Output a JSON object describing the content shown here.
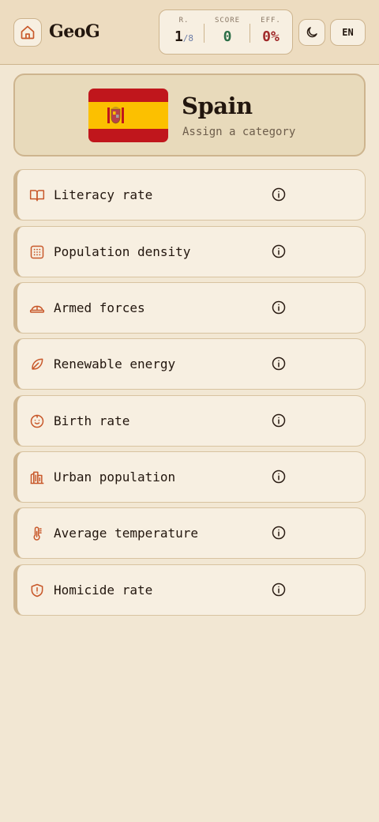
{
  "header": {
    "app_name": "GeoG",
    "home_icon": "home-icon",
    "stats": {
      "round_label": "R.",
      "round_value": "1",
      "round_total": "/8",
      "score_label": "SCORE",
      "score_value": "0",
      "efficiency_label": "EFF.",
      "efficiency_value": "0%"
    },
    "theme_icon": "moon-icon",
    "language": "EN"
  },
  "country": {
    "name": "Spain",
    "subtitle": "Assign a category",
    "flag_colors": {
      "red": "#c0161c",
      "yellow": "#fcc000"
    }
  },
  "categories": [
    {
      "label": "Literacy rate",
      "icon": "book-icon"
    },
    {
      "label": "Population density",
      "icon": "grid-icon"
    },
    {
      "label": "Armed forces",
      "icon": "helmet-icon"
    },
    {
      "label": "Renewable energy",
      "icon": "leaf-icon"
    },
    {
      "label": "Birth rate",
      "icon": "baby-icon"
    },
    {
      "label": "Urban population",
      "icon": "buildings-icon"
    },
    {
      "label": "Average temperature",
      "icon": "thermometer-icon"
    },
    {
      "label": "Homicide rate",
      "icon": "shield-icon"
    }
  ],
  "colors": {
    "accent": "#c8582a",
    "background": "#f2e7d3",
    "card": "#f7efe1",
    "border": "#cdb48e"
  }
}
